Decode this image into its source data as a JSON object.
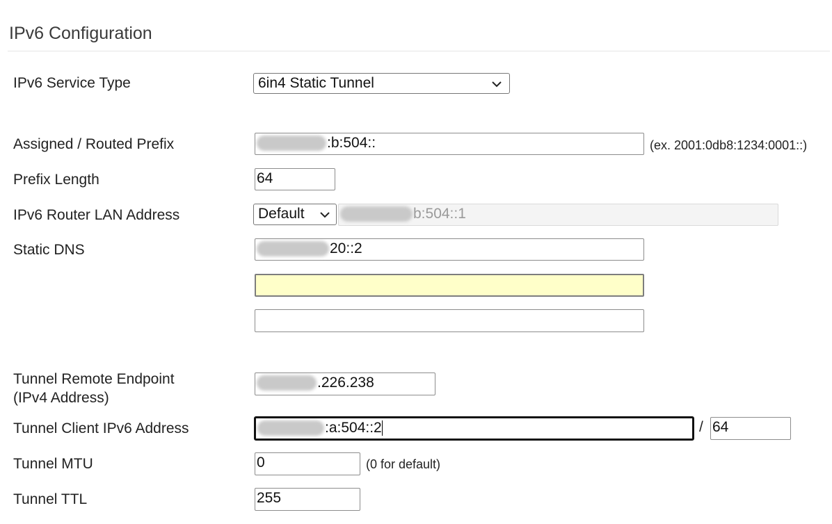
{
  "section": {
    "title": "IPv6 Configuration"
  },
  "service_type": {
    "label": "IPv6 Service Type",
    "selected": "6in4 Static Tunnel"
  },
  "prefix": {
    "label": "Assigned / Routed Prefix",
    "value": ":b:504::",
    "hint": "(ex. 2001:0db8:1234:0001::)"
  },
  "prefix_length": {
    "label": "Prefix Length",
    "value": "64"
  },
  "router_lan": {
    "label": "IPv6 Router LAN Address",
    "mode": "Default",
    "value": "b:504::1"
  },
  "static_dns": {
    "label": "Static DNS",
    "dns1": "20::2",
    "dns2": "",
    "dns3": ""
  },
  "tunnel_remote": {
    "label_line1": "Tunnel Remote Endpoint",
    "label_line2": "(IPv4 Address)",
    "value": ".226.238"
  },
  "tunnel_client": {
    "label": "Tunnel Client IPv6 Address",
    "value": ":a:504::2",
    "separator": "/",
    "prefix": "64"
  },
  "tunnel_mtu": {
    "label": "Tunnel MTU",
    "value": "0",
    "hint": "(0 for default)"
  },
  "tunnel_ttl": {
    "label": "Tunnel TTL",
    "value": "255"
  },
  "icons": {
    "dropdown": "chevron-down-icon",
    "redaction": "redacted-blur"
  },
  "colors": {
    "highlight_field": "#ffffc9",
    "readonly_field": "#f4f4f4"
  }
}
